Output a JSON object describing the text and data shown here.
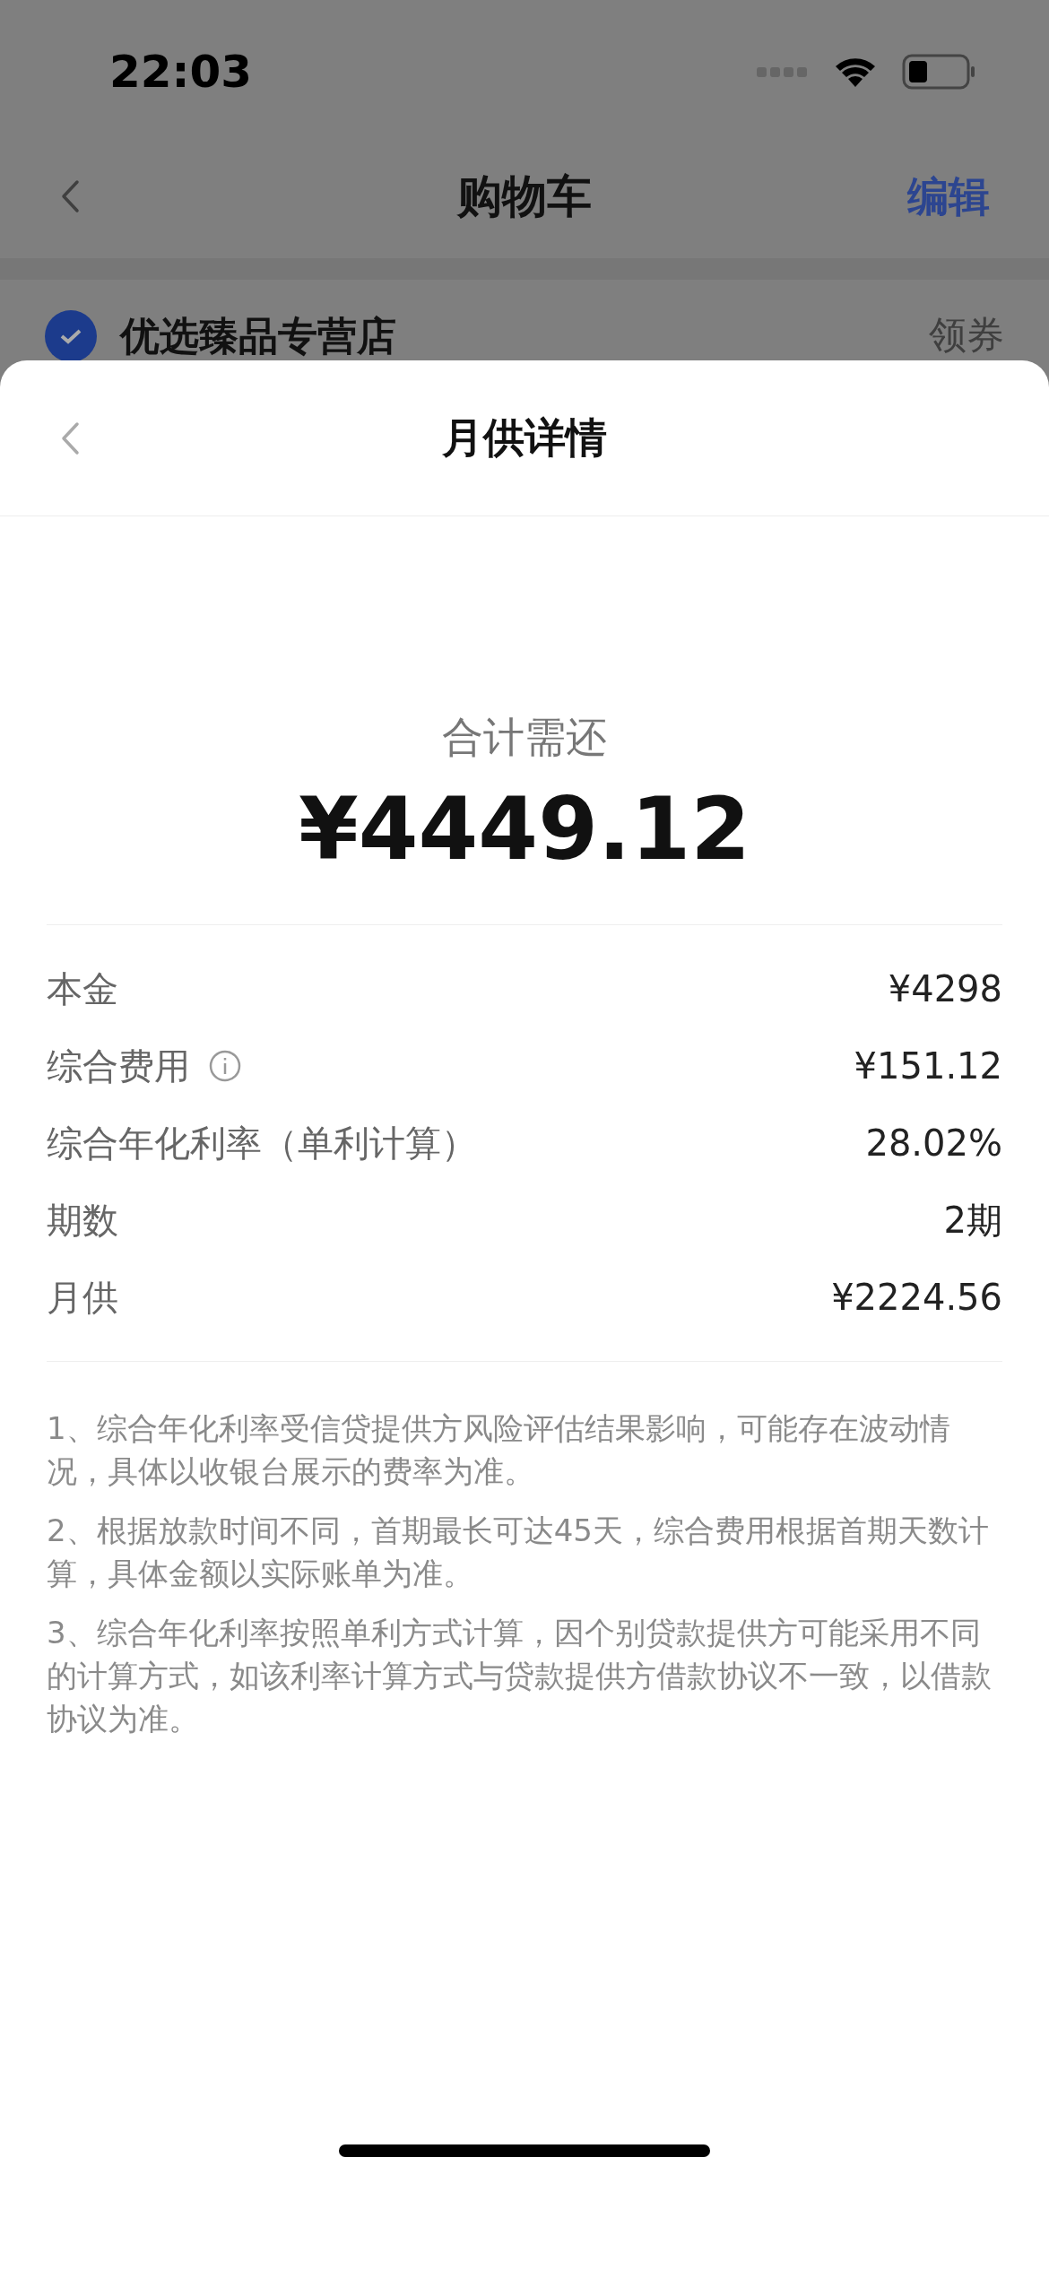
{
  "status_bar": {
    "time": "22:03"
  },
  "background_page": {
    "nav": {
      "title": "购物车",
      "action": "编辑"
    },
    "store": {
      "name": "优选臻品专营店",
      "checked": true,
      "coupon": "领券"
    }
  },
  "sheet": {
    "title": "月供详情",
    "total_label": "合计需还",
    "total": "¥4449.12",
    "rows": [
      {
        "label": "本金",
        "value": "¥4298",
        "info": false
      },
      {
        "label": "综合费用",
        "value": "¥151.12",
        "info": true
      },
      {
        "label": "综合年化利率（单利计算）",
        "value": "28.02%",
        "info": false
      },
      {
        "label": "期数",
        "value": "2期",
        "info": false
      },
      {
        "label": "月供",
        "value": "¥2224.56",
        "info": false
      }
    ],
    "notes": [
      "1、综合年化利率受信贷提供方风险评估结果影响，可能存在波动情况，具体以收银台展示的费率为准。",
      "2、根据放款时间不同，首期最长可达45天，综合费用根据首期天数计算，具体金额以实际账单为准。",
      "3、综合年化利率按照单利方式计算，因个别贷款提供方可能采用不同的计算方式，如该利率计算方式与贷款提供方借款协议不一致，以借款协议为准。"
    ]
  }
}
